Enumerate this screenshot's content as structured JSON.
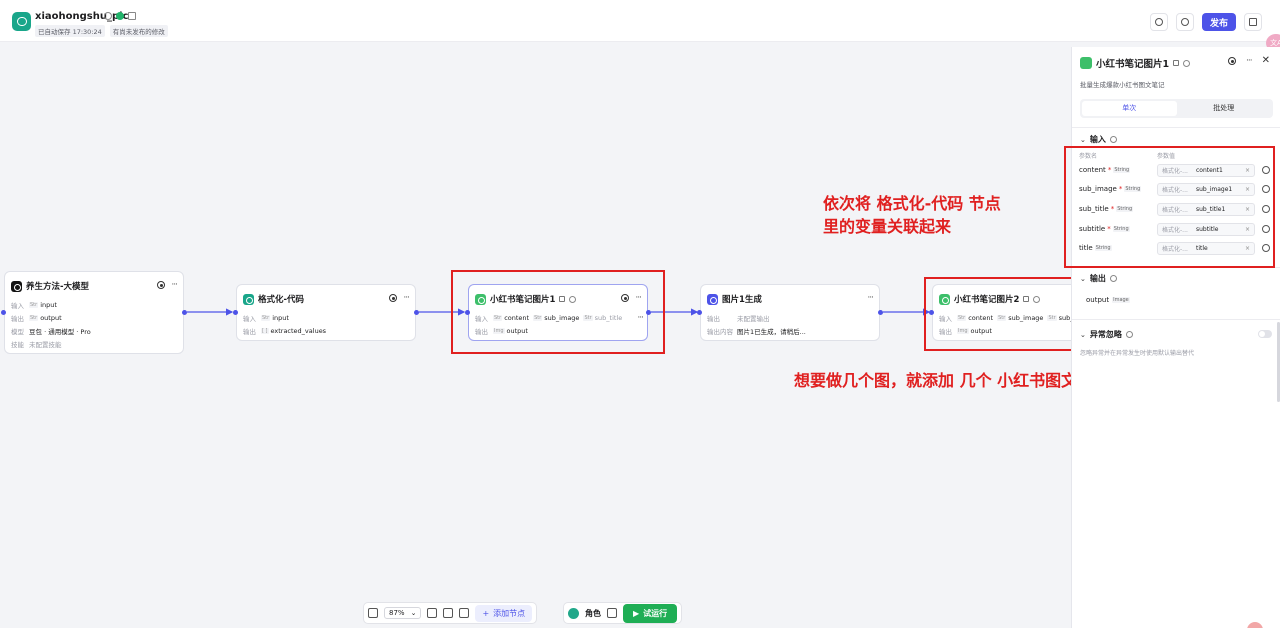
{
  "header": {
    "app_name": "xiaohongshu_pic",
    "autosave": "已自动保存 17:30:24",
    "unpublished": "有尚未发布的修改",
    "publish_label": "发布",
    "lang_bubble": "文A"
  },
  "nodes": [
    {
      "title": "养生方法-大模型",
      "icon_color": "#111111",
      "rows": [
        {
          "label": "输入",
          "type": "Str",
          "value": "input"
        },
        {
          "label": "输出",
          "type": "Str",
          "value": "output"
        },
        {
          "label": "模型",
          "value": "豆包 · 通用模型 · Pro"
        },
        {
          "label": "技能",
          "value": "未配置技能"
        }
      ]
    },
    {
      "title": "格式化-代码",
      "icon_color": "#19a68a",
      "rows": [
        {
          "label": "输入",
          "type": "Str",
          "value": "input"
        },
        {
          "label": "输出",
          "type": "[ ]",
          "value": "extracted_values"
        }
      ]
    },
    {
      "title": "小红书笔记图片1",
      "icon_color": "#3dbf6a",
      "inputs": [
        "content",
        "sub_image",
        "sub_title"
      ],
      "output_label": "输出",
      "output_value": "output"
    },
    {
      "title": "图片1生成",
      "icon_color": "#4d53e8",
      "rows": [
        {
          "label": "输出",
          "value": "未配置输出"
        },
        {
          "label": "输出内容",
          "value": "图片1已生成，请稍后..."
        }
      ]
    },
    {
      "title": "小红书笔记图片2",
      "icon_color": "#3dbf6a",
      "inputs": [
        "content",
        "sub_image",
        "sub_title"
      ],
      "output_value": "output"
    }
  ],
  "row_labels": {
    "input": "输入",
    "output": "输出"
  },
  "annotations": {
    "top_line1": "依次将 格式化-代码 节点",
    "top_line2": "里的变量关联起来",
    "bottom": "想要做几个图，就添加 几个 小红书图文工作流"
  },
  "panel": {
    "title": "小红书笔记图片1",
    "description": "批量生成爆款小红书图文笔记",
    "tabs": [
      "单次",
      "批处理"
    ],
    "input_section": "输入",
    "param_name_header": "参数名",
    "param_value_header": "参数值",
    "params": [
      {
        "name": "content",
        "required": true,
        "type": "String",
        "source": "格式化-...",
        "ref": "content1"
      },
      {
        "name": "sub_image",
        "required": true,
        "type": "String",
        "source": "格式化-...",
        "ref": "sub_image1"
      },
      {
        "name": "sub_title",
        "required": true,
        "type": "String",
        "source": "格式化-...",
        "ref": "sub_title1"
      },
      {
        "name": "subtitle",
        "required": true,
        "type": "String",
        "source": "格式化-...",
        "ref": "subtitle"
      },
      {
        "name": "title",
        "required": false,
        "type": "String",
        "source": "格式化-...",
        "ref": "title"
      }
    ],
    "output_section": "输出",
    "output_name": "output",
    "output_type": "Image",
    "error_section": "异常忽略",
    "error_desc": "忽略异常并在异常发生时使用默认输出替代"
  },
  "toolbar": {
    "zoom": "87%",
    "add_node": "添加节点",
    "role": "角色",
    "run": "试运行"
  }
}
